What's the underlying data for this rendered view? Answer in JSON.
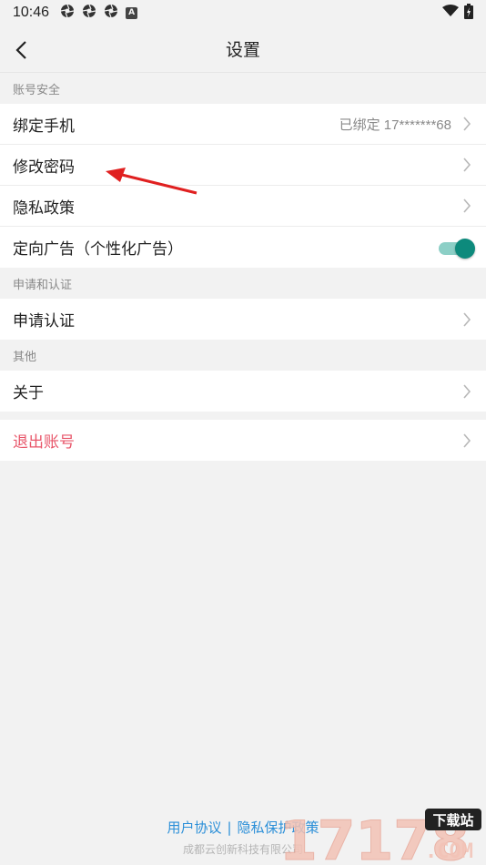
{
  "status_bar": {
    "time": "10:46",
    "notif_letter": "A"
  },
  "nav": {
    "title": "设置"
  },
  "sections": {
    "account": {
      "header": "账号安全",
      "bind_phone_label": "绑定手机",
      "bind_phone_value": "已绑定 17*******68",
      "change_password_label": "修改密码",
      "privacy_policy_label": "隐私政策",
      "targeted_ads_label": "定向广告（个性化广告）",
      "targeted_ads_on": true
    },
    "certification": {
      "header": "申请和认证",
      "apply_label": "申请认证"
    },
    "other": {
      "header": "其他",
      "about_label": "关于"
    },
    "logout": {
      "label": "退出账号"
    }
  },
  "footer": {
    "user_agreement": "用户协议",
    "separator": "|",
    "privacy_policy": "隐私保护政策",
    "copyright": "成都云创新科技有限公司"
  },
  "watermark": {
    "text_main": "17178",
    "text_sub": "下载站",
    "text_com": ".COM"
  },
  "colors": {
    "accent_teal": "#0d8a7c",
    "logout_red": "#e8566a",
    "link_blue": "#2b8fd8",
    "annotation_red": "#e02020"
  }
}
